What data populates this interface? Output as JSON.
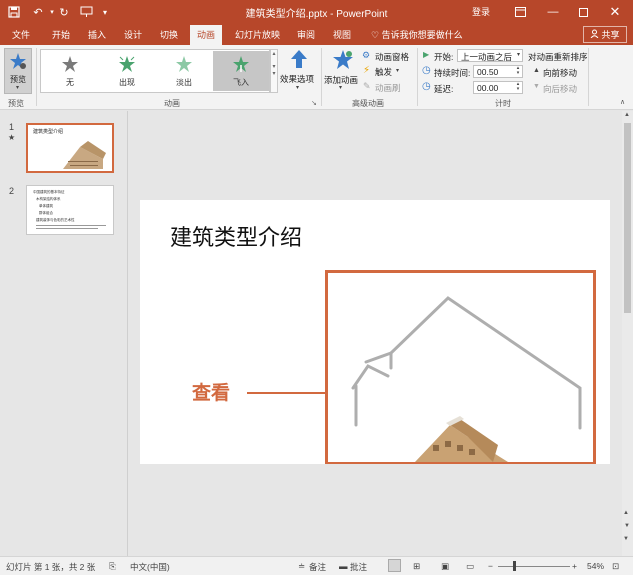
{
  "window": {
    "title": "建筑类型介绍.pptx - PowerPoint",
    "login": "登录",
    "share": "共享",
    "tell_me": "告诉我你想要做什么"
  },
  "tabs": [
    "文件",
    "开始",
    "插入",
    "设计",
    "切换",
    "动画",
    "幻灯片放映",
    "审阅",
    "视图"
  ],
  "ribbon": {
    "preview": {
      "label": "预览",
      "group_label": "预览"
    },
    "animation_group": {
      "label": "动画",
      "items": [
        {
          "label": "无",
          "icon": "star-none-icon"
        },
        {
          "label": "出现",
          "icon": "star-appear-icon"
        },
        {
          "label": "淡出",
          "icon": "star-fade-icon"
        },
        {
          "label": "飞入",
          "icon": "star-flyin-icon",
          "selected": true
        }
      ],
      "effect_options": "效果选项"
    },
    "advanced_group": {
      "label": "高级动画",
      "add_animation": "添加动画",
      "animation_pane": "动画窗格",
      "trigger": "触发",
      "animation_painter": "动画刷"
    },
    "timing_group": {
      "label": "计时",
      "start_label": "开始:",
      "start_value": "上一动画之后",
      "duration_label": "持续时间:",
      "duration_value": "00.50",
      "delay_label": "延迟:",
      "delay_value": "00.00",
      "reorder_title": "对动画重新排序",
      "move_earlier": "向前移动",
      "move_later": "向后移动"
    }
  },
  "slides_pane": {
    "slides": [
      {
        "number": "1",
        "anim_marker": "★",
        "title": "建筑类型介绍",
        "selected": true
      },
      {
        "number": "2",
        "lines": [
          "中国建筑的基本特征",
          "木构架结构体系",
          "单体建筑",
          "群体组合",
          "建筑装饰与色彩的艺术性"
        ]
      }
    ]
  },
  "slide": {
    "title": "建筑类型介绍",
    "callout": "查看"
  },
  "statusbar": {
    "slide_info": "幻灯片 第 1 张，共 2 张",
    "language": "中文(中国)",
    "notes": "备注",
    "comments": "批注",
    "zoom": "54%"
  },
  "colors": {
    "accent": "#b7472a",
    "callout": "#d2693f"
  }
}
